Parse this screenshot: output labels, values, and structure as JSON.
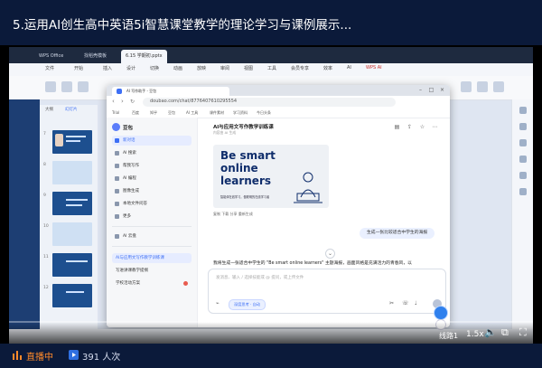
{
  "course": {
    "title": "5.运用AI创生高中英语5i智慧课堂教学的理论学习与课例展示..."
  },
  "wps": {
    "tabs": [
      "WPS Office",
      "找稻壳模板",
      "6.15 学期初.pptx"
    ],
    "menus": [
      "文件",
      "开始",
      "插入",
      "设计",
      "切换",
      "动画",
      "放映",
      "审阅",
      "视图",
      "工具",
      "会员专享",
      "效率",
      "AI"
    ],
    "ai_label": "WPS AI",
    "thumb_tabs": [
      "大纲",
      "幻灯片"
    ],
    "slide_numbers": [
      "7",
      "8",
      "9",
      "10",
      "11",
      "12"
    ]
  },
  "browser": {
    "tab_title": "AI 写作助手 - 豆包",
    "address": "doubao.com/chat/8776407610295554",
    "bookmarks": [
      "Trial",
      "百度",
      "知乎",
      "豆包",
      "AI 工具",
      "课件素材",
      "学习资料",
      "今日头条"
    ]
  },
  "doubao": {
    "brand": "豆包",
    "nav": [
      {
        "label": "新对话",
        "active": true
      },
      {
        "label": "AI 搜索",
        "active": false
      },
      {
        "label": "帮我写作",
        "active": false
      },
      {
        "label": "AI 编程",
        "active": false
      },
      {
        "label": "图像生成",
        "active": false
      },
      {
        "label": "本地文件问答",
        "active": false
      },
      {
        "label": "更多",
        "active": false
      }
    ],
    "section_ai": "AI 云盘",
    "history": [
      "AI与应用文写作教学训练课",
      "写进讲课教学提纲",
      "学校活动方案"
    ],
    "chat": {
      "title": "AI与应用文写作教学训练课",
      "subtitle": "内容由 AI 生成",
      "poster_line1": "Be smart",
      "poster_line2": "online",
      "poster_line3": "learners",
      "poster_small": "智能体在线学习，做聪明的在线学习者",
      "actions": "复制   下载   分享   重新生成",
      "user_message": "生成一张比较适合中学生的海报",
      "reply": "我将生成一张适合中学生的 \"Be smart online learners\" 主题海报，画面风格是充满活力的青春风，以",
      "input_placeholder": "发消息、输入 / 选择技能或 @ 提问，或上传文件",
      "deep_think": "深度思考 · 自动"
    }
  },
  "player": {
    "quality": "线路1",
    "speed": "1.5x"
  },
  "footer": {
    "live": "直播中",
    "viewers": "391 人次"
  },
  "colors": {
    "accent": "#3d6ff5",
    "live": "#ff8a2a",
    "frame": "#0b1a3a"
  }
}
